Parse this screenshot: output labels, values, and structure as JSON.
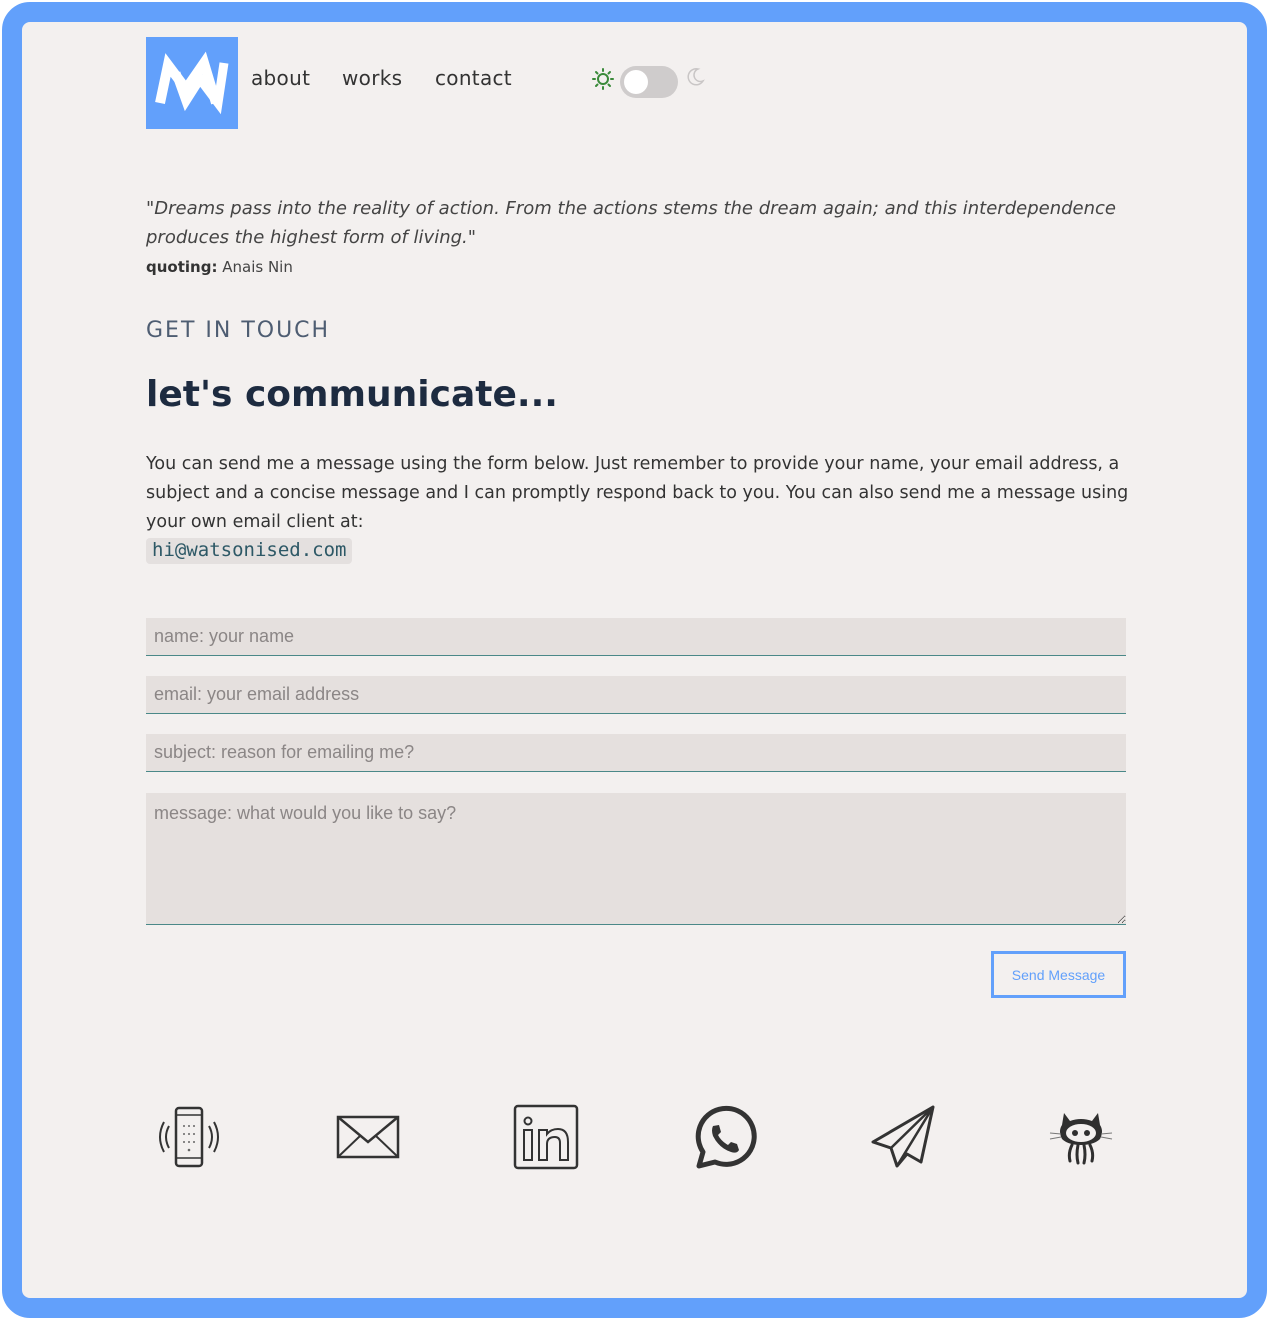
{
  "header": {
    "logo_alt": "MW",
    "nav": [
      {
        "label": "about"
      },
      {
        "label": "works"
      },
      {
        "label": "contact"
      }
    ],
    "theme_toggle": {
      "state": "light",
      "sun_color": "#3a8a3a"
    }
  },
  "quote": {
    "text": "\"Dreams pass into the reality of action. From the actions stems the dream again; and this interdependence produces the highest form of living.\"",
    "label": "quoting:",
    "author": "Anais Nin"
  },
  "section": {
    "kicker": "GET IN TOUCH",
    "heading": "let's communicate...",
    "intro": "You can send me a message using the form below. Just remember to provide your name, your email address, a subject and a concise message and I can promptly respond back to you. You can also send me a message using your own email client at:",
    "email": "hi@watsonised.com"
  },
  "form": {
    "name_placeholder": "name: your name",
    "email_placeholder": "email: your email address",
    "subject_placeholder": "subject: reason for emailing me?",
    "message_placeholder": "message: what would you like to say?",
    "send_label": "Send Message"
  },
  "socials": [
    {
      "icon": "phone-icon"
    },
    {
      "icon": "mail-icon"
    },
    {
      "icon": "linkedin-icon"
    },
    {
      "icon": "whatsapp-icon"
    },
    {
      "icon": "telegram-icon"
    },
    {
      "icon": "github-icon"
    }
  ],
  "colors": {
    "accent": "#62a0fb",
    "background": "#f3f0ef",
    "heading": "#1d2b40",
    "field_bg": "#e5e0de"
  }
}
